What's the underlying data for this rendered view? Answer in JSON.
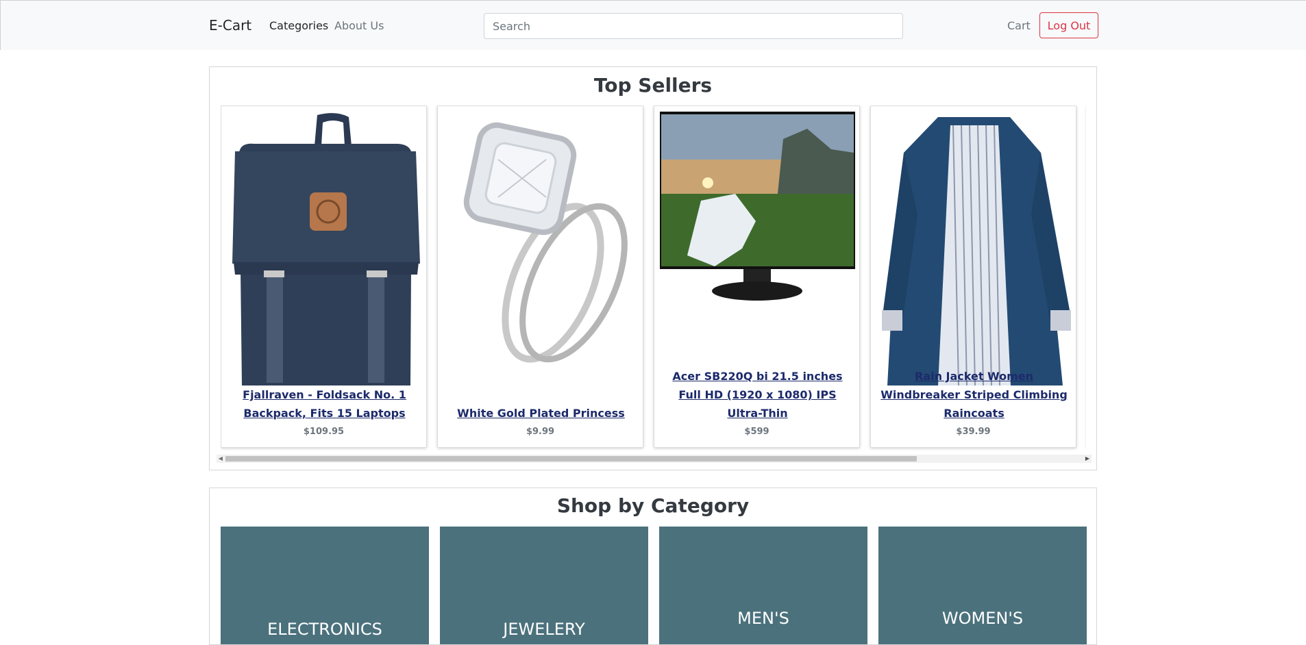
{
  "navbar": {
    "brand": "E-Cart",
    "links": [
      "Categories",
      "About Us"
    ],
    "search_placeholder": "Search",
    "cart_label": "Cart",
    "logout_label": "Log Out"
  },
  "top_sellers": {
    "title": "Top Sellers",
    "products": [
      {
        "title": "Fjallraven - Foldsack No. 1 Backpack, Fits 15 Laptops",
        "price": "$109.95",
        "icon": "backpack-image"
      },
      {
        "title": "White Gold Plated Princess",
        "price": "$9.99",
        "icon": "ring-image"
      },
      {
        "title": "Acer SB220Q bi 21.5 inches Full HD (1920 x 1080) IPS Ultra-Thin",
        "price": "$599",
        "icon": "monitor-image"
      },
      {
        "title": "Rain Jacket Women Windbreaker Striped Climbing Raincoats",
        "price": "$39.99",
        "icon": "jacket-image"
      }
    ]
  },
  "categories": {
    "title": "Shop by Category",
    "items": [
      "ELECTRONICS",
      "JEWELERY",
      "MEN'S",
      "WOMEN'S"
    ]
  },
  "colors": {
    "tile": "#4b717c",
    "logout": "#dc3545",
    "link": "#1c2a6b"
  }
}
